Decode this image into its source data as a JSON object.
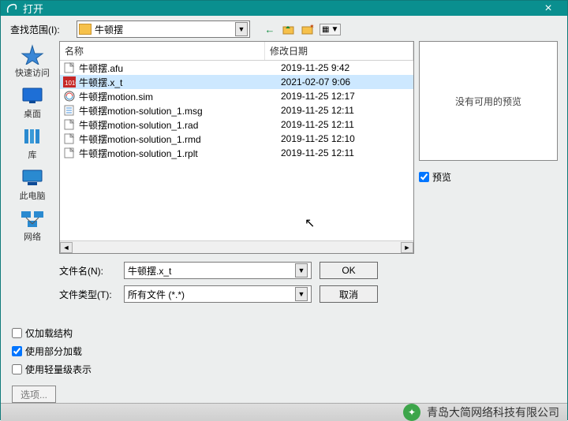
{
  "title": "打开",
  "lookin_label": "查找范围(I):",
  "lookin_value": "牛顿摆",
  "columns": {
    "name": "名称",
    "date": "修改日期"
  },
  "files": [
    {
      "name": "牛顿摆.afu",
      "date": "2019-11-25 9:42",
      "icon": "generic",
      "selected": false
    },
    {
      "name": "牛顿摆.x_t",
      "date": "2021-02-07 9:06",
      "icon": "red",
      "selected": true
    },
    {
      "name": "牛顿摆motion.sim",
      "date": "2019-11-25 12:17",
      "icon": "sim",
      "selected": false
    },
    {
      "name": "牛顿摆motion-solution_1.msg",
      "date": "2019-11-25 12:11",
      "icon": "doc",
      "selected": false
    },
    {
      "name": "牛顿摆motion-solution_1.rad",
      "date": "2019-11-25 12:11",
      "icon": "generic",
      "selected": false
    },
    {
      "name": "牛顿摆motion-solution_1.rmd",
      "date": "2019-11-25 12:10",
      "icon": "generic",
      "selected": false
    },
    {
      "name": "牛顿摆motion-solution_1.rplt",
      "date": "2019-11-25 12:11",
      "icon": "generic",
      "selected": false
    }
  ],
  "places": [
    {
      "key": "quick",
      "label": "快速访问"
    },
    {
      "key": "desktop",
      "label": "桌面"
    },
    {
      "key": "libraries",
      "label": "库"
    },
    {
      "key": "thispc",
      "label": "此电脑"
    },
    {
      "key": "network",
      "label": "网络"
    }
  ],
  "filename_label": "文件名(N):",
  "filename_value": "牛顿摆.x_t",
  "filetype_label": "文件类型(T):",
  "filetype_value": "所有文件 (*.*)",
  "ok_label": "OK",
  "cancel_label": "取消",
  "preview_empty": "没有可用的预览",
  "preview_chk": {
    "label": "预览",
    "checked": true
  },
  "options": {
    "load_struct": {
      "label": "仅加载结构",
      "checked": false
    },
    "partial_load": {
      "label": "使用部分加载",
      "checked": true
    },
    "lightweight": {
      "label": "使用轻量级表示",
      "checked": false
    },
    "options_btn": "选项..."
  },
  "footer_text": "青岛大简网络科技有限公司"
}
